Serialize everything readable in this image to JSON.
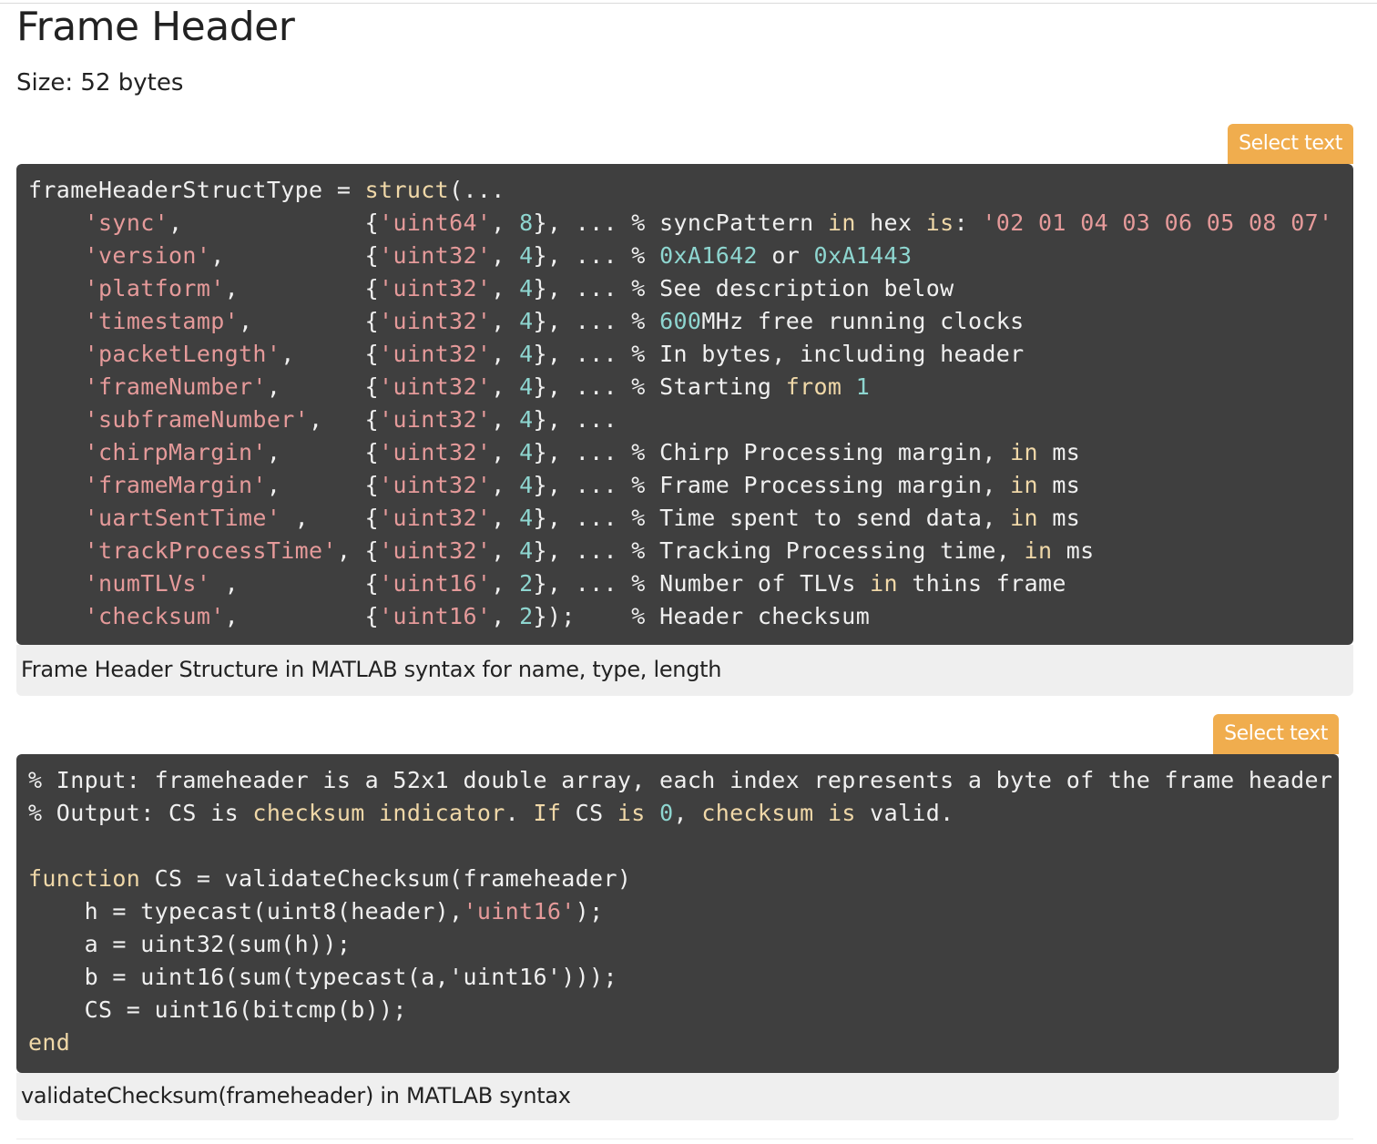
{
  "section": {
    "title": "Frame Header",
    "size_text": "Size: 52 bytes"
  },
  "buttons": {
    "select_text_1": "Select text",
    "select_text_2": "Select text"
  },
  "code_blocks": [
    {
      "language": "MATLAB",
      "lines": [
        [
          {
            "t": "frameHeaderStructType = ",
            "c": "plain"
          },
          {
            "t": "struct",
            "c": "kw"
          },
          {
            "t": "(...",
            "c": "plain"
          }
        ],
        [
          {
            "t": "    ",
            "c": "plain"
          },
          {
            "t": "'sync'",
            "c": "str"
          },
          {
            "t": ",             {",
            "c": "plain"
          },
          {
            "t": "'uint64'",
            "c": "str"
          },
          {
            "t": ", ",
            "c": "plain"
          },
          {
            "t": "8",
            "c": "num"
          },
          {
            "t": "}, ... % syncPattern ",
            "c": "plain"
          },
          {
            "t": "in",
            "c": "kw"
          },
          {
            "t": " hex ",
            "c": "plain"
          },
          {
            "t": "is",
            "c": "kw"
          },
          {
            "t": ": ",
            "c": "plain"
          },
          {
            "t": "'02 01 04 03 06 05 08 07'",
            "c": "str"
          }
        ],
        [
          {
            "t": "    ",
            "c": "plain"
          },
          {
            "t": "'version'",
            "c": "str"
          },
          {
            "t": ",          {",
            "c": "plain"
          },
          {
            "t": "'uint32'",
            "c": "str"
          },
          {
            "t": ", ",
            "c": "plain"
          },
          {
            "t": "4",
            "c": "num"
          },
          {
            "t": "}, ... % ",
            "c": "plain"
          },
          {
            "t": "0xA1642",
            "c": "num"
          },
          {
            "t": " or ",
            "c": "plain"
          },
          {
            "t": "0xA1443",
            "c": "num"
          }
        ],
        [
          {
            "t": "    ",
            "c": "plain"
          },
          {
            "t": "'platform'",
            "c": "str"
          },
          {
            "t": ",         {",
            "c": "plain"
          },
          {
            "t": "'uint32'",
            "c": "str"
          },
          {
            "t": ", ",
            "c": "plain"
          },
          {
            "t": "4",
            "c": "num"
          },
          {
            "t": "}, ... % See description below",
            "c": "plain"
          }
        ],
        [
          {
            "t": "    ",
            "c": "plain"
          },
          {
            "t": "'timestamp'",
            "c": "str"
          },
          {
            "t": ",        {",
            "c": "plain"
          },
          {
            "t": "'uint32'",
            "c": "str"
          },
          {
            "t": ", ",
            "c": "plain"
          },
          {
            "t": "4",
            "c": "num"
          },
          {
            "t": "}, ... % ",
            "c": "plain"
          },
          {
            "t": "600",
            "c": "num"
          },
          {
            "t": "MHz free running clocks",
            "c": "plain"
          }
        ],
        [
          {
            "t": "    ",
            "c": "plain"
          },
          {
            "t": "'packetLength'",
            "c": "str"
          },
          {
            "t": ",     {",
            "c": "plain"
          },
          {
            "t": "'uint32'",
            "c": "str"
          },
          {
            "t": ", ",
            "c": "plain"
          },
          {
            "t": "4",
            "c": "num"
          },
          {
            "t": "}, ... % In bytes, including header",
            "c": "plain"
          }
        ],
        [
          {
            "t": "    ",
            "c": "plain"
          },
          {
            "t": "'frameNumber'",
            "c": "str"
          },
          {
            "t": ",      {",
            "c": "plain"
          },
          {
            "t": "'uint32'",
            "c": "str"
          },
          {
            "t": ", ",
            "c": "plain"
          },
          {
            "t": "4",
            "c": "num"
          },
          {
            "t": "}, ... % Starting ",
            "c": "plain"
          },
          {
            "t": "from",
            "c": "kw"
          },
          {
            "t": " ",
            "c": "plain"
          },
          {
            "t": "1",
            "c": "num"
          }
        ],
        [
          {
            "t": "    ",
            "c": "plain"
          },
          {
            "t": "'subframeNumber'",
            "c": "str"
          },
          {
            "t": ",   {",
            "c": "plain"
          },
          {
            "t": "'uint32'",
            "c": "str"
          },
          {
            "t": ", ",
            "c": "plain"
          },
          {
            "t": "4",
            "c": "num"
          },
          {
            "t": "}, ...",
            "c": "plain"
          }
        ],
        [
          {
            "t": "    ",
            "c": "plain"
          },
          {
            "t": "'chirpMargin'",
            "c": "str"
          },
          {
            "t": ",      {",
            "c": "plain"
          },
          {
            "t": "'uint32'",
            "c": "str"
          },
          {
            "t": ", ",
            "c": "plain"
          },
          {
            "t": "4",
            "c": "num"
          },
          {
            "t": "}, ... % Chirp Processing margin, ",
            "c": "plain"
          },
          {
            "t": "in",
            "c": "kw"
          },
          {
            "t": " ms",
            "c": "plain"
          }
        ],
        [
          {
            "t": "    ",
            "c": "plain"
          },
          {
            "t": "'frameMargin'",
            "c": "str"
          },
          {
            "t": ",      {",
            "c": "plain"
          },
          {
            "t": "'uint32'",
            "c": "str"
          },
          {
            "t": ", ",
            "c": "plain"
          },
          {
            "t": "4",
            "c": "num"
          },
          {
            "t": "}, ... % Frame Processing margin, ",
            "c": "plain"
          },
          {
            "t": "in",
            "c": "kw"
          },
          {
            "t": " ms",
            "c": "plain"
          }
        ],
        [
          {
            "t": "    ",
            "c": "plain"
          },
          {
            "t": "'uartSentTime'",
            "c": "str"
          },
          {
            "t": " ,    {",
            "c": "plain"
          },
          {
            "t": "'uint32'",
            "c": "str"
          },
          {
            "t": ", ",
            "c": "plain"
          },
          {
            "t": "4",
            "c": "num"
          },
          {
            "t": "}, ... % Time spent to send data, ",
            "c": "plain"
          },
          {
            "t": "in",
            "c": "kw"
          },
          {
            "t": " ms",
            "c": "plain"
          }
        ],
        [
          {
            "t": "    ",
            "c": "plain"
          },
          {
            "t": "'trackProcessTime'",
            "c": "str"
          },
          {
            "t": ", {",
            "c": "plain"
          },
          {
            "t": "'uint32'",
            "c": "str"
          },
          {
            "t": ", ",
            "c": "plain"
          },
          {
            "t": "4",
            "c": "num"
          },
          {
            "t": "}, ... % Tracking Processing time, ",
            "c": "plain"
          },
          {
            "t": "in",
            "c": "kw"
          },
          {
            "t": " ms",
            "c": "plain"
          }
        ],
        [
          {
            "t": "    ",
            "c": "plain"
          },
          {
            "t": "'numTLVs'",
            "c": "str"
          },
          {
            "t": " ,         {",
            "c": "plain"
          },
          {
            "t": "'uint16'",
            "c": "str"
          },
          {
            "t": ", ",
            "c": "plain"
          },
          {
            "t": "2",
            "c": "num"
          },
          {
            "t": "}, ... % Number of TLVs ",
            "c": "plain"
          },
          {
            "t": "in",
            "c": "kw"
          },
          {
            "t": " thins frame",
            "c": "plain"
          }
        ],
        [
          {
            "t": "    ",
            "c": "plain"
          },
          {
            "t": "'checksum'",
            "c": "str"
          },
          {
            "t": ",         {",
            "c": "plain"
          },
          {
            "t": "'uint16'",
            "c": "str"
          },
          {
            "t": ", ",
            "c": "plain"
          },
          {
            "t": "2",
            "c": "num"
          },
          {
            "t": "});    % Header checksum",
            "c": "plain"
          }
        ]
      ]
    },
    {
      "language": "MATLAB",
      "lines": [
        [
          {
            "t": "% Input: frameheader is a 52x1 double array, each index represents a byte of the frame header",
            "c": "plain"
          }
        ],
        [
          {
            "t": "% Output: CS is ",
            "c": "plain"
          },
          {
            "t": "checksum indicator",
            "c": "kw"
          },
          {
            "t": ". ",
            "c": "plain"
          },
          {
            "t": "If",
            "c": "kw"
          },
          {
            "t": " CS ",
            "c": "plain"
          },
          {
            "t": "is",
            "c": "kw"
          },
          {
            "t": " ",
            "c": "plain"
          },
          {
            "t": "0",
            "c": "num"
          },
          {
            "t": ", ",
            "c": "plain"
          },
          {
            "t": "checksum",
            "c": "kw"
          },
          {
            "t": " ",
            "c": "plain"
          },
          {
            "t": "is",
            "c": "kw"
          },
          {
            "t": " valid.",
            "c": "plain"
          }
        ],
        [
          {
            "t": "",
            "c": "plain"
          }
        ],
        [
          {
            "t": "function",
            "c": "kw"
          },
          {
            "t": " CS = validateChecksum(frameheader)",
            "c": "plain"
          }
        ],
        [
          {
            "t": "    h = typecast(uint8(header),",
            "c": "plain"
          },
          {
            "t": "'uint16'",
            "c": "str"
          },
          {
            "t": ");",
            "c": "plain"
          }
        ],
        [
          {
            "t": "    a = uint32(sum(h));",
            "c": "plain"
          }
        ],
        [
          {
            "t": "    b = uint16(sum(typecast(a,'uint16')));",
            "c": "plain"
          }
        ],
        [
          {
            "t": "    CS = uint16(bitcmp(b));",
            "c": "plain"
          }
        ],
        [
          {
            "t": "end",
            "c": "kw"
          }
        ]
      ]
    }
  ],
  "captions": {
    "caption_1": "Frame Header Structure in MATLAB syntax for name, type, length",
    "caption_2": "validateChecksum(frameheader) in MATLAB syntax"
  },
  "colors": {
    "code_background": "#3f3f3f",
    "code_text": "#f0f0f0",
    "keyword": "#f0d8a8",
    "string": "#e59a9a",
    "number": "#8ed6d0",
    "button": "#f0ad4e",
    "caption_background": "#efefef"
  }
}
